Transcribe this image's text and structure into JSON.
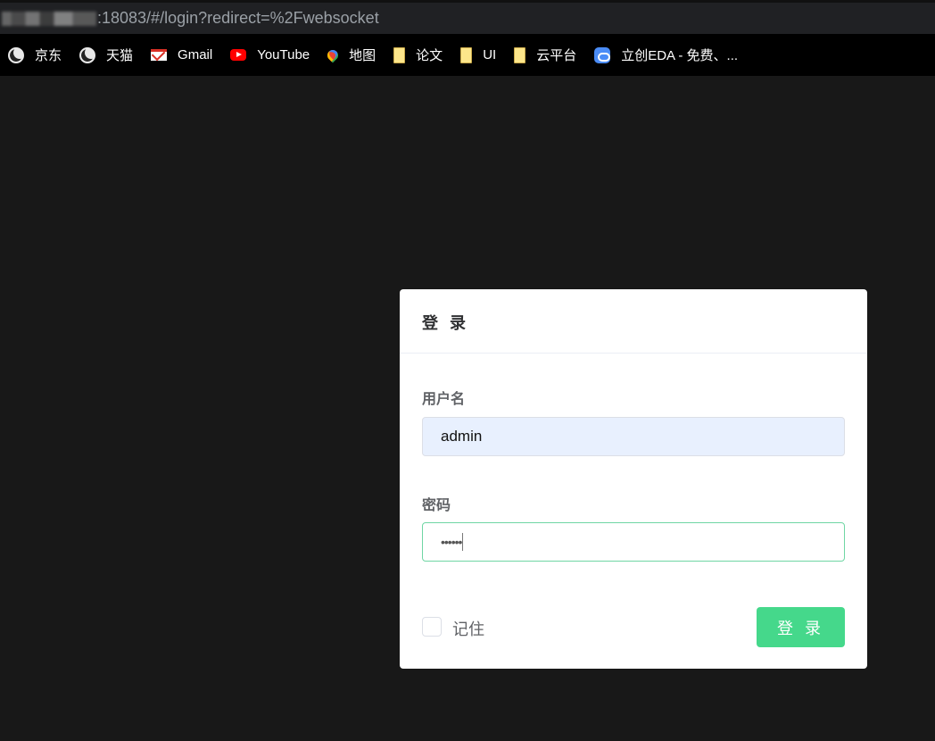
{
  "browser": {
    "url_visible": ":18083/#/login?redirect=%2Fwebsocket",
    "bookmarks": [
      {
        "label": "京东",
        "icon": "globe-icon"
      },
      {
        "label": "天猫",
        "icon": "globe-icon"
      },
      {
        "label": "Gmail",
        "icon": "gmail-icon"
      },
      {
        "label": "YouTube",
        "icon": "youtube-icon"
      },
      {
        "label": "地图",
        "icon": "maps-pin-icon"
      },
      {
        "label": "论文",
        "icon": "folder-icon"
      },
      {
        "label": "UI",
        "icon": "folder-icon"
      },
      {
        "label": "云平台",
        "icon": "folder-icon"
      },
      {
        "label": "立创EDA - 免费、...",
        "icon": "eda-cloud-icon"
      }
    ]
  },
  "login": {
    "title": "登 录",
    "username_label": "用户名",
    "username_value": "admin",
    "password_label": "密码",
    "password_mask": "••••••",
    "remember_label": "记住",
    "remember_checked": false,
    "submit_label": "登 录",
    "colors": {
      "primary": "#45d88b",
      "autofill_bg": "#e8f0fe",
      "focus_border": "#6fd6a4"
    }
  }
}
